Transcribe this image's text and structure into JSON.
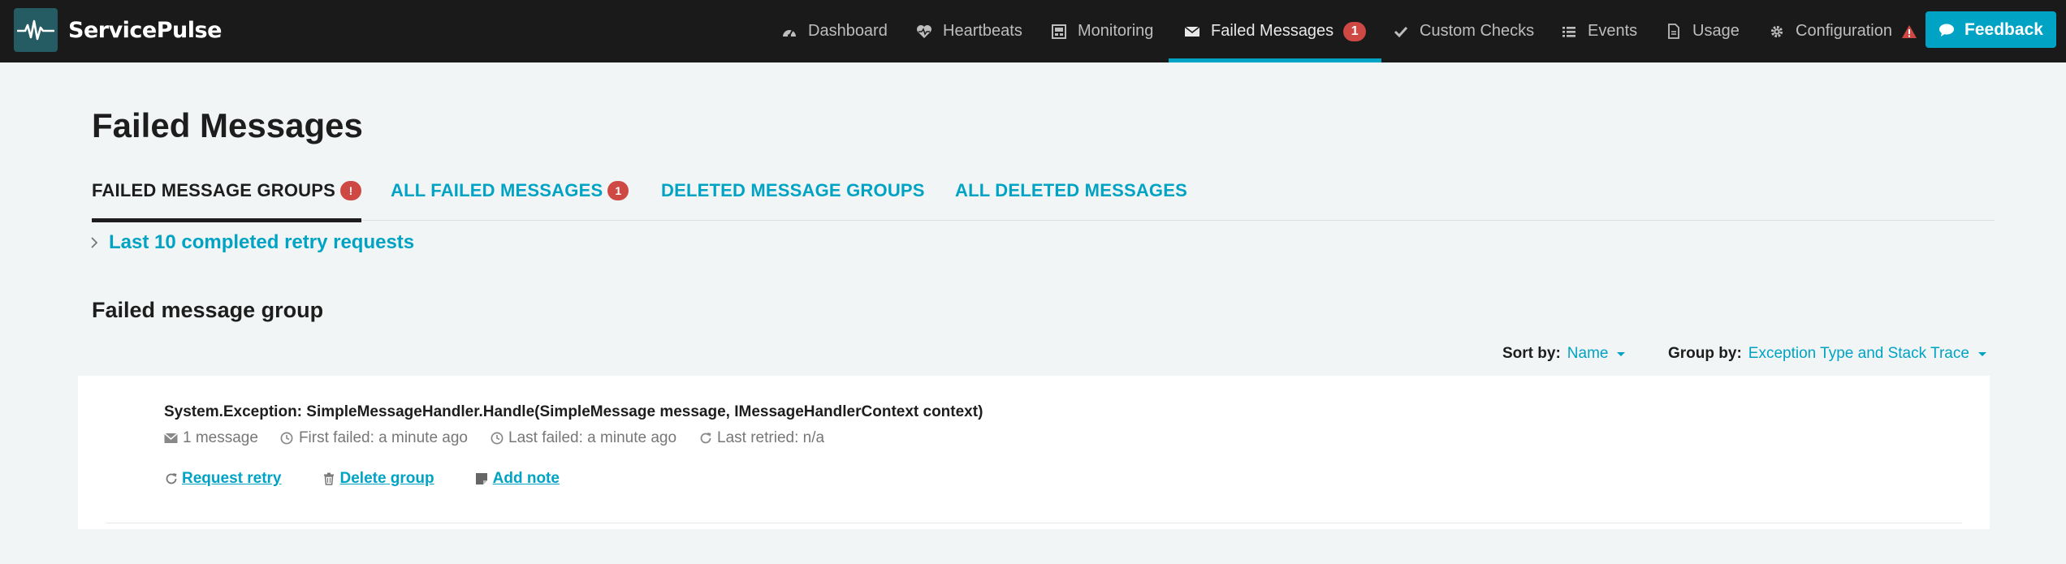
{
  "app": {
    "name": "ServicePulse"
  },
  "nav": {
    "items": [
      {
        "label": "Dashboard",
        "icon": "dashboard-icon"
      },
      {
        "label": "Heartbeats",
        "icon": "heartbeat-icon"
      },
      {
        "label": "Monitoring",
        "icon": "monitoring-icon"
      },
      {
        "label": "Failed Messages",
        "icon": "envelope-icon",
        "badge": "1",
        "active": true
      },
      {
        "label": "Custom Checks",
        "icon": "check-icon"
      },
      {
        "label": "Events",
        "icon": "list-icon"
      },
      {
        "label": "Usage",
        "icon": "document-icon"
      },
      {
        "label": "Configuration",
        "icon": "gear-icon",
        "warning_icon": "warning-icon"
      }
    ],
    "feedback_label": "Feedback",
    "feedback_icon": "comment-icon"
  },
  "page": {
    "title": "Failed Messages",
    "tabs": [
      {
        "label": "FAILED MESSAGE GROUPS",
        "badge": "!",
        "active": true
      },
      {
        "label": "ALL FAILED MESSAGES",
        "badge": "1"
      },
      {
        "label": "DELETED MESSAGE GROUPS"
      },
      {
        "label": "ALL DELETED MESSAGES"
      }
    ],
    "retry_history_label": "Last 10 completed retry requests",
    "section_title": "Failed message group",
    "sort": {
      "label": "Sort by:",
      "value": "Name"
    },
    "group_by": {
      "label": "Group by:",
      "value": "Exception Type and Stack Trace"
    }
  },
  "groups": [
    {
      "title": "System.Exception: SimpleMessageHandler.Handle(SimpleMessage message, IMessageHandlerContext context)",
      "meta": {
        "count": "1 message",
        "first_failed": "First failed: a minute ago",
        "last_failed": "Last failed: a minute ago",
        "last_retried": "Last retried: n/a"
      },
      "actions": {
        "retry": "Request retry",
        "delete": "Delete group",
        "note": "Add note"
      }
    }
  ],
  "colors": {
    "navbar": "#1a1a1a",
    "accent": "#00a3c4",
    "badge": "#ce4844",
    "page_bg": "#f2f5f5",
    "logo_bg": "#255c64"
  }
}
